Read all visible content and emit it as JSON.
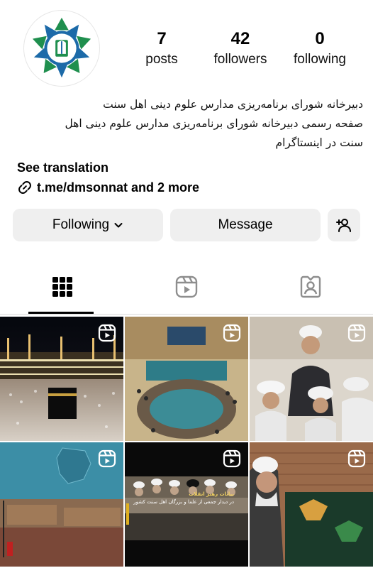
{
  "profile": {
    "avatar_icon": "seal-logo-icon",
    "stats": [
      {
        "value": "7",
        "label": "posts"
      },
      {
        "value": "42",
        "label": "followers"
      },
      {
        "value": "0",
        "label": "following"
      }
    ],
    "bio_line1": "دبیرخانه شورای برنامه‌ریزی مدارس علوم دینی اهل سنت",
    "bio_line2": "صفحه رسمی دبیرخانه شورای برنامه‌ریزی مدارس علوم دینی اهل",
    "bio_line3": "سنت در اینستاگرام",
    "see_translation": "See translation",
    "link_text": "t.me/dmsonnat and 2 more"
  },
  "actions": {
    "following_label": "Following",
    "message_label": "Message"
  },
  "tabs": [
    {
      "icon": "grid-icon",
      "selected": true
    },
    {
      "icon": "reels-icon",
      "selected": false
    },
    {
      "icon": "tagged-icon",
      "selected": false
    }
  ],
  "posts": [
    {
      "type": "reel",
      "scene": "kaaba-night"
    },
    {
      "type": "reel",
      "scene": "conference-hall"
    },
    {
      "type": "reel",
      "scene": "scholars-meeting"
    },
    {
      "type": "reel",
      "scene": "meeting-room-map"
    },
    {
      "type": "reel",
      "scene": "leader-meeting",
      "caption_line1": "بیانات رهبر انقلاب",
      "caption_line2": "در دیدار جمعی از علما و بزرگان اهل سنت کشور"
    },
    {
      "type": "reel",
      "scene": "elder-portrait"
    }
  ],
  "colors": {
    "button_bg": "#efefef",
    "divider": "#dbdbdb",
    "logo_blue": "#1c6aa8",
    "logo_green": "#1f8f4e"
  }
}
